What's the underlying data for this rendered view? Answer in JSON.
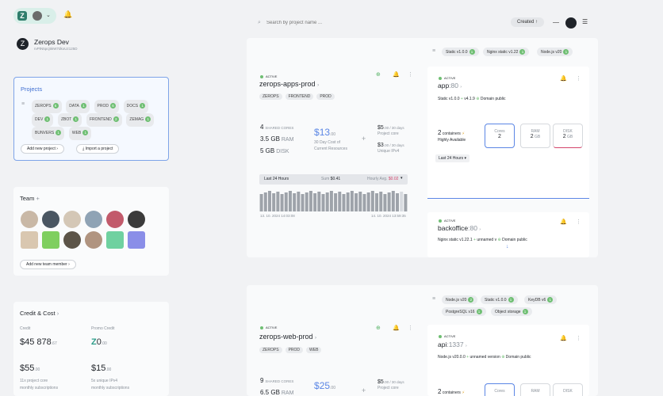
{
  "topbar": {
    "bell_icon": "bell-icon"
  },
  "org": {
    "name": "Zerops Dev",
    "id": "rvPtN5pcj5kW7dkoUz125D"
  },
  "projects_card": {
    "title": "Projects",
    "tags": [
      {
        "label": "ZEROPS",
        "count": "6"
      },
      {
        "label": "DATA",
        "count": "1"
      },
      {
        "label": "PROD",
        "count": "6"
      },
      {
        "label": "DOCS",
        "count": "1"
      },
      {
        "label": "DEV",
        "count": "1"
      },
      {
        "label": "ZBOT",
        "count": "1"
      },
      {
        "label": "FRONTEND",
        "count": "2"
      },
      {
        "label": "ZEMAG",
        "count": "1"
      },
      {
        "label": "BUNVERS",
        "count": "1"
      },
      {
        "label": "WEB",
        "count": "1"
      }
    ],
    "add_project": "Add new project",
    "import_project": "Import a project"
  },
  "team_card": {
    "title": "Team",
    "add_member": "Add new team member"
  },
  "credit_card": {
    "title": "Credit & Cost",
    "credit_label": "Credit",
    "credit_value": "45 878",
    "credit_cents": ".67",
    "promo_label": "Promo Credit",
    "promo_value": "0",
    "promo_cents": ".00",
    "core_cost": "55",
    "core_cents": ".00",
    "core_desc1": "11x project core",
    "core_desc2": "monthly subscriptions",
    "ipv4_cost": "15",
    "ipv4_cents": ".00",
    "ipv4_desc1": "5x unique IPv4",
    "ipv4_desc2": "monthly subscriptions"
  },
  "search": {
    "placeholder": "Search by project name ..."
  },
  "sort": {
    "label": "Created"
  },
  "project1": {
    "status": "ACTIVE",
    "name": "zerops-apps-prod",
    "tags": [
      "ZEROPS",
      "FRONTEND",
      "PROD"
    ],
    "cores": "4",
    "cores_label": "SHARED CORES",
    "ram": "3.5 GB",
    "ram_label": "RAM",
    "disk": "5 GB",
    "disk_label": "DISK",
    "cost": "13",
    "cost_cents": ".00",
    "cost_desc1": "30 Day Cost of",
    "cost_desc2": "Current Resources",
    "core_price": "5",
    "core_price_cents": ".00 / 30 days",
    "core_price_label": "Project core",
    "ipv4_price": "3",
    "ipv4_price_cents": ".00 / 30 days",
    "ipv4_price_label": "Unique IPv4",
    "period": "Last 24 Hours",
    "sum_label": "Sum",
    "sum_value": "$0.41",
    "avg_label": "Hourly Avg.",
    "avg_value": "$0.02",
    "time_start": "13. 10. 2024 14:03:08",
    "time_end": "14. 10. 2024 13:59:35",
    "filters": [
      {
        "label": "Static v1.0.0",
        "count": "1"
      },
      {
        "label": "Nginx static v1.22",
        "count": "1"
      },
      {
        "label": "Node.js v20",
        "count": "1"
      }
    ],
    "svc1": {
      "status": "ACTIVE",
      "name": "app",
      "port": ":80",
      "info1": "Static v1.0.0",
      "info2": "v4.1.9",
      "domain": "Domain public",
      "containers": "2",
      "containers_label": "containers",
      "ha": "Highly Available",
      "cores_label": "Cores",
      "cores_val": "2",
      "ram_label": "RAM",
      "ram_val": "2",
      "ram_unit": "GB",
      "disk_label": "DISK",
      "disk_val": "2",
      "disk_unit": "GB",
      "period": "Last 24 Hours"
    },
    "svc2": {
      "status": "ACTIVE",
      "name": "backoffice",
      "port": ":80",
      "info1": "Nginx static v1.22.1",
      "info2": "unnamed v",
      "domain": "Domain public"
    }
  },
  "project2": {
    "status": "ACTIVE",
    "name": "zerops-web-prod",
    "tags": [
      "ZEROPS",
      "PROD",
      "WEB"
    ],
    "cores": "9",
    "cores_label": "SHARED CORES",
    "ram": "6.5 GB",
    "ram_label": "RAM",
    "cost": "25",
    "cost_cents": ".00",
    "core_price": "5",
    "core_price_cents": ".00 / 30 days",
    "core_price_label": "Project core",
    "filters": [
      {
        "label": "Node.js v20",
        "count": "2"
      },
      {
        "label": "Static v1.0.0",
        "count": "1"
      },
      {
        "label": "KeyDB v6",
        "count": "1"
      },
      {
        "label": "PostgreSQL v16",
        "count": "1"
      },
      {
        "label": "Object storage",
        "count": "1"
      }
    ],
    "svc1": {
      "status": "ACTIVE",
      "name": "api",
      "port": ":1337",
      "info1": "Node.js v20.0.0",
      "info2": "unnamed version",
      "domain": "Domain public",
      "containers": "2",
      "containers_label": "containers",
      "cores_label": "Cores",
      "ram_label": "RAM",
      "disk_label": "DISK"
    }
  },
  "colors": {
    "green": "#6fbf73",
    "accent": "#5b86e5",
    "bg": "#f1f2f4"
  }
}
